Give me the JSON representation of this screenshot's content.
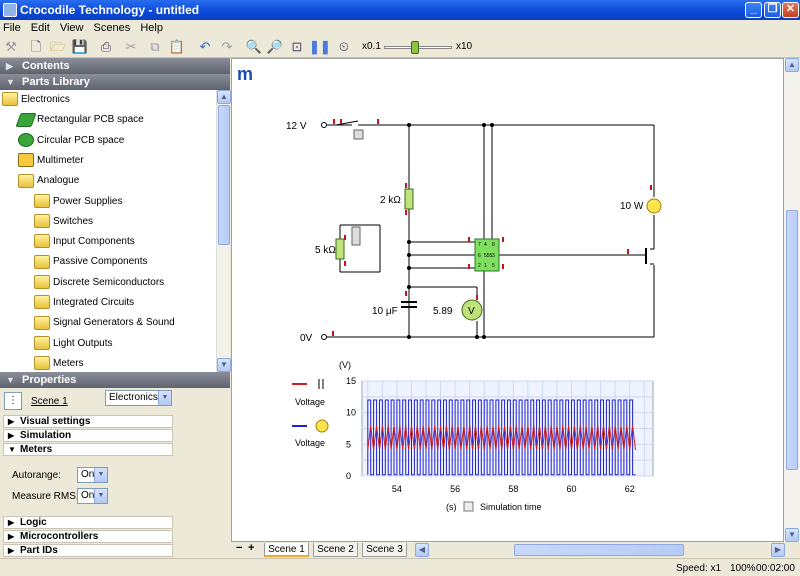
{
  "window": {
    "title": "Crocodile Technology - untitled"
  },
  "menu": [
    "File",
    "Edit",
    "View",
    "Scenes",
    "Help"
  ],
  "toolbar": {
    "speed_min": "x0.1",
    "speed_max": "x10",
    "speed_level": 0.45
  },
  "sections": {
    "contents": "Contents",
    "parts_library": "Parts Library",
    "properties": "Properties"
  },
  "tree": [
    {
      "label": "Electronics",
      "icon": "folder-icon"
    },
    {
      "label": "Rectangular PCB space",
      "icon": "pcb-rect-icon"
    },
    {
      "label": "Circular PCB space",
      "icon": "pcb-circle-icon"
    },
    {
      "label": "Multimeter",
      "icon": "multimeter-icon"
    },
    {
      "label": "Analogue",
      "icon": "folder-icon"
    },
    {
      "label": "Power Supplies",
      "icon": "folder-icon"
    },
    {
      "label": "Switches",
      "icon": "folder-icon"
    },
    {
      "label": "Input Components",
      "icon": "folder-icon"
    },
    {
      "label": "Passive Components",
      "icon": "folder-icon"
    },
    {
      "label": "Discrete Semiconductors",
      "icon": "folder-icon"
    },
    {
      "label": "Integrated Circuits",
      "icon": "folder-icon"
    },
    {
      "label": "Signal Generators & Sound",
      "icon": "folder-icon"
    },
    {
      "label": "Light Outputs",
      "icon": "folder-icon"
    },
    {
      "label": "Meters",
      "icon": "folder-icon"
    }
  ],
  "properties": {
    "scene_label": "Scene 1",
    "scene_type": "Electronics",
    "groups": [
      "Visual settings",
      "Simulation",
      "Meters",
      "Logic",
      "Microcontrollers",
      "Part IDs"
    ],
    "autorange_label": "Autorange:",
    "autorange_value": "On",
    "rms_label": "Measure RMS:",
    "rms_value": "On"
  },
  "circuit": {
    "supply": "12 V",
    "ground": "0V",
    "r1": "2 kΩ",
    "pot": "5 kΩ",
    "cap": "10 μF",
    "lamp": "10 W",
    "voltmeter_reading": "5.89",
    "voltmeter_symbol": "V",
    "ic_label": "555",
    "ic_pins": [
      "7",
      "4",
      "8",
      "6",
      "3",
      "2",
      "1",
      "5"
    ]
  },
  "chart_data": {
    "type": "line",
    "ylabel": "(V)",
    "xlabel": "Simulation time",
    "x_unit": "(s)",
    "xlim": [
      52.8,
      62.8
    ],
    "ylim": [
      0,
      15
    ],
    "xticks": [
      54,
      56,
      58,
      60,
      62
    ],
    "yticks": [
      0,
      5,
      10,
      15
    ],
    "grid": true,
    "series": [
      {
        "name": "Voltage",
        "color": "#cc2020",
        "style": "triangle",
        "low": 4.1,
        "high": 8.0,
        "period": 0.2,
        "x_start": 53.0,
        "x_end": 62.2
      },
      {
        "name": "Voltage",
        "color": "#2020cc",
        "style": "square",
        "low": 0.2,
        "high": 12.0,
        "period": 0.2,
        "x_start": 53.0,
        "x_end": 62.2
      }
    ]
  },
  "scene_tabs": [
    "Scene 1",
    "Scene 2",
    "Scene 3"
  ],
  "status": {
    "speed": "Speed: x1",
    "zoom": "100%",
    "time": "00:02:00"
  }
}
